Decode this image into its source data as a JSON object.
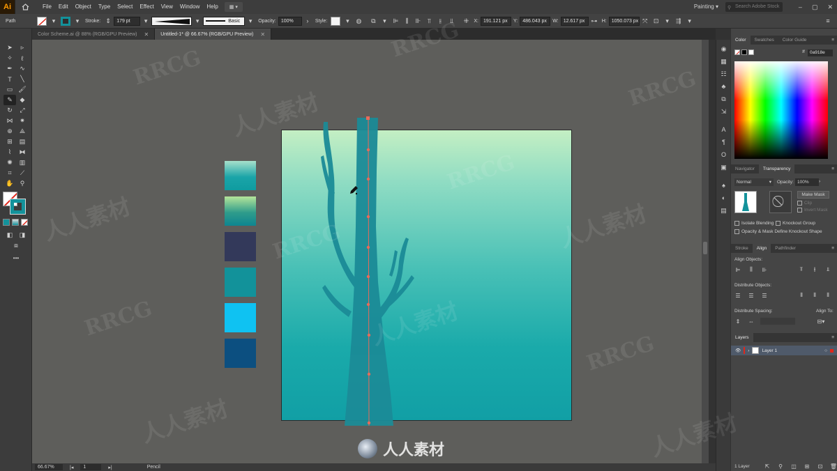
{
  "app": {
    "logo": "Ai",
    "menus": [
      "File",
      "Edit",
      "Object",
      "Type",
      "Select",
      "Effect",
      "View",
      "Window",
      "Help"
    ],
    "workspace": "Painting",
    "search_placeholder": "Search Adobe Stock"
  },
  "control_bar": {
    "object_type": "Path",
    "stroke_label": "Stroke:",
    "stroke_value": "179 pt",
    "brush_profile": "Basic",
    "opacity_label": "Opacity:",
    "opacity_value": "100%",
    "style_label": "Style:",
    "x_label": "X:",
    "x_value": "191.121 px",
    "y_label": "Y:",
    "y_value": "486.043 px",
    "w_label": "W:",
    "w_value": "12.617 px",
    "h_label": "H:",
    "h_value": "1050.073 px"
  },
  "tabs": [
    {
      "label": "Color Scheme.ai @ 88% (RGB/GPU Preview)",
      "active": false
    },
    {
      "label": "Untitled-1* @ 66.67% (RGB/GPU Preview)",
      "active": true
    }
  ],
  "status_bar": {
    "zoom": "66.67%",
    "artboard": "1",
    "tool": "Pencil"
  },
  "color_panel": {
    "tabs": [
      "Color",
      "Swatches",
      "Color Guide"
    ],
    "hex_value": "0a918e"
  },
  "transparency_panel": {
    "tabs": [
      "Navigator",
      "Transparency"
    ],
    "blend_mode": "Normal",
    "opacity_label": "Opacity:",
    "opacity_value": "100%",
    "make_mask": "Make Mask",
    "clip": "Clip",
    "invert_mask": "Invert Mask",
    "isolate_blending": "Isolate Blending",
    "knockout_group": "Knockout Group",
    "opacity_mask_define": "Opacity & Mask Define Knockout Shape"
  },
  "align_panel": {
    "tabs": [
      "Stroke",
      "Align",
      "Pathfinder"
    ],
    "align_objects": "Align Objects:",
    "distribute_objects": "Distribute Objects:",
    "distribute_spacing": "Distribute Spacing:",
    "align_to": "Align To:"
  },
  "layers_panel": {
    "tab": "Layers",
    "layer_name": "Layer 1",
    "layer_count": "1 Layer"
  },
  "swatches_on_canvas": [
    {
      "name": "gradient-teal",
      "color": "#1aa4a8"
    },
    {
      "name": "gradient-green-teal",
      "color": "#3fa68a"
    },
    {
      "name": "dark-navy",
      "color": "#33395a"
    },
    {
      "name": "teal",
      "color": "#12929a"
    },
    {
      "name": "bright-cyan",
      "color": "#0fc2f2"
    },
    {
      "name": "deep-blue",
      "color": "#0c4f80"
    }
  ],
  "watermarks": [
    "RRCG",
    "人人素材"
  ],
  "bottom_logo_text": "人人素材",
  "colors": {
    "accent_stroke": "#13929b",
    "tree_color": "#1b8b97",
    "anchor_color": "#e86b5a"
  }
}
